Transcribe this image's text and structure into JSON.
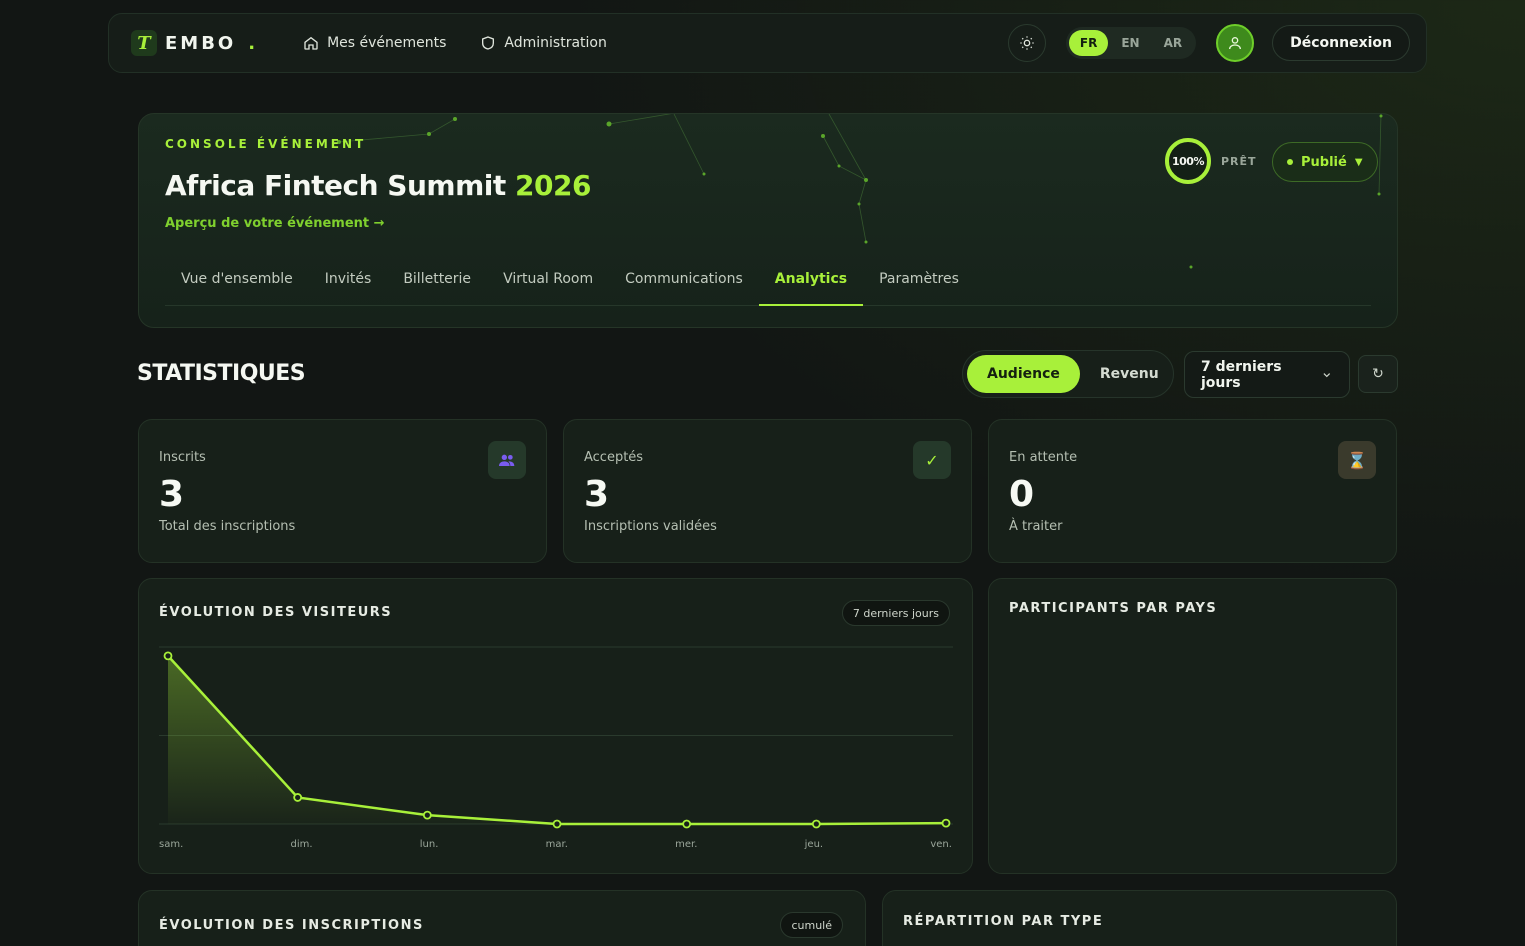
{
  "nav": {
    "brand_name": "EMBO",
    "brand_dot": ".",
    "links": [
      {
        "label": "Mes événements",
        "icon": "home-icon"
      },
      {
        "label": "Administration",
        "icon": "shield-icon"
      }
    ],
    "languages": [
      "FR",
      "EN",
      "AR"
    ],
    "active_language": "FR",
    "logout_label": "Déconnexion"
  },
  "console": {
    "kicker": "CONSOLE ÉVÉNEMENT",
    "title": "Africa Fintech Summit",
    "year": "2026",
    "preview_link": "Aperçu de votre événement →",
    "readiness": "100%",
    "readiness_fraction": 1.0,
    "ready_label": "PRÊT",
    "status": "Publié",
    "tabs": [
      "Vue d'ensemble",
      "Invités",
      "Billetterie",
      "Virtual Room",
      "Communications",
      "Analytics",
      "Paramètres"
    ],
    "active_tab": "Analytics"
  },
  "stats": {
    "title": "STATISTIQUES",
    "segments": [
      "Audience",
      "Revenu"
    ],
    "active_segment": "Audience",
    "range": "7 derniers jours",
    "refresh_icon": "refresh-icon"
  },
  "kpis": [
    {
      "label": "Inscrits",
      "value": "3",
      "sub": "Total des inscriptions",
      "icon": "users-icon",
      "icon_color": "#7a5cf0",
      "icon_bg": "#25392a"
    },
    {
      "label": "Acceptés",
      "value": "3",
      "sub": "Inscriptions validées",
      "icon": "check-icon",
      "icon_color": "#a8f03a",
      "icon_bg": "#25392a"
    },
    {
      "label": "En attente",
      "value": "0",
      "sub": "À traiter",
      "icon": "hourglass-icon",
      "icon_color": "#e8c07a",
      "icon_bg": "#3a3a2c"
    }
  ],
  "panels": {
    "visitors_title": "ÉVOLUTION DES VISITEURS",
    "visitors_chip": "7 derniers jours",
    "countries_title": "PARTICIPANTS PAR PAYS",
    "registrations_title": "ÉVOLUTION DES INSCRIPTIONS",
    "registrations_chip": "cumulé",
    "types_title": "RÉPARTITION PAR TYPE"
  },
  "chart_data": {
    "type": "area",
    "categories": [
      "sam.",
      "dim.",
      "lun.",
      "mar.",
      "mer.",
      "jeu.",
      "ven."
    ],
    "values": [
      9.5,
      1.5,
      0.5,
      0,
      0,
      0,
      0.05
    ],
    "ylim": [
      0,
      10
    ],
    "grid": true,
    "line_color": "#a8f03a"
  }
}
